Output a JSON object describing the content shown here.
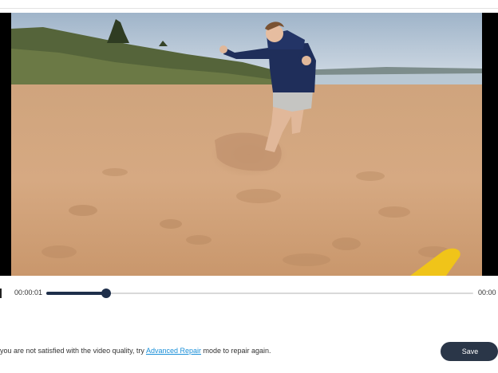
{
  "player": {
    "video_description": "boy kicking sand on a beach",
    "current_time": "00:00:01",
    "total_time": "00:00",
    "progress_fraction": 0.14
  },
  "footer": {
    "message_before": "you are not satisfied with the video quality, try ",
    "message_link": "Advanced Repair",
    "message_after": " mode to repair again.",
    "save_label": "Save"
  },
  "colors": {
    "accent": "#1e2f4a",
    "link": "#1a8fd8",
    "button": "#2a3648"
  }
}
